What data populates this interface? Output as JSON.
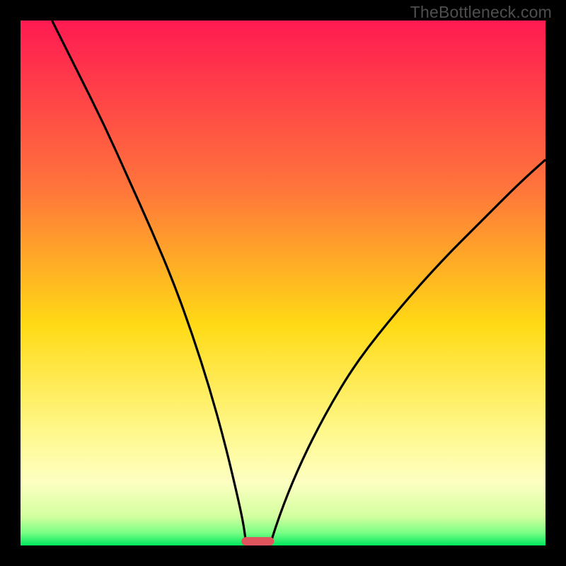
{
  "watermark": {
    "text": "TheBottleneck.com"
  },
  "chart_data": {
    "type": "line",
    "title": "",
    "xlabel": "",
    "ylabel": "",
    "xlim": [
      0,
      1
    ],
    "ylim": [
      0,
      1
    ],
    "background_gradient": [
      {
        "stop": 0.0,
        "color": "#ff1a52"
      },
      {
        "stop": 0.32,
        "color": "#ff753b"
      },
      {
        "stop": 0.58,
        "color": "#ffda15"
      },
      {
        "stop": 0.78,
        "color": "#fff88a"
      },
      {
        "stop": 0.88,
        "color": "#fdffc2"
      },
      {
        "stop": 0.945,
        "color": "#d3ff9f"
      },
      {
        "stop": 0.975,
        "color": "#7cff85"
      },
      {
        "stop": 1.0,
        "color": "#00e85e"
      }
    ],
    "series": [
      {
        "name": "left-curve",
        "points": [
          {
            "x": 0.06,
            "y": 1.0
          },
          {
            "x": 0.11,
            "y": 0.9
          },
          {
            "x": 0.16,
            "y": 0.8
          },
          {
            "x": 0.205,
            "y": 0.7
          },
          {
            "x": 0.25,
            "y": 0.6
          },
          {
            "x": 0.292,
            "y": 0.5
          },
          {
            "x": 0.328,
            "y": 0.4
          },
          {
            "x": 0.36,
            "y": 0.3
          },
          {
            "x": 0.388,
            "y": 0.2
          },
          {
            "x": 0.412,
            "y": 0.1
          },
          {
            "x": 0.425,
            "y": 0.04
          },
          {
            "x": 0.43,
            "y": 0.0
          }
        ]
      },
      {
        "name": "right-curve",
        "points": [
          {
            "x": 0.475,
            "y": 0.0
          },
          {
            "x": 0.49,
            "y": 0.05
          },
          {
            "x": 0.53,
            "y": 0.15
          },
          {
            "x": 0.58,
            "y": 0.25
          },
          {
            "x": 0.64,
            "y": 0.35
          },
          {
            "x": 0.72,
            "y": 0.45
          },
          {
            "x": 0.8,
            "y": 0.54
          },
          {
            "x": 0.88,
            "y": 0.62
          },
          {
            "x": 0.95,
            "y": 0.69
          },
          {
            "x": 1.0,
            "y": 0.735
          }
        ]
      }
    ],
    "optimum_marker": {
      "x_center": 0.452,
      "y": 0.0,
      "width": 0.062,
      "height": 0.016,
      "color": "#e0545e"
    }
  }
}
